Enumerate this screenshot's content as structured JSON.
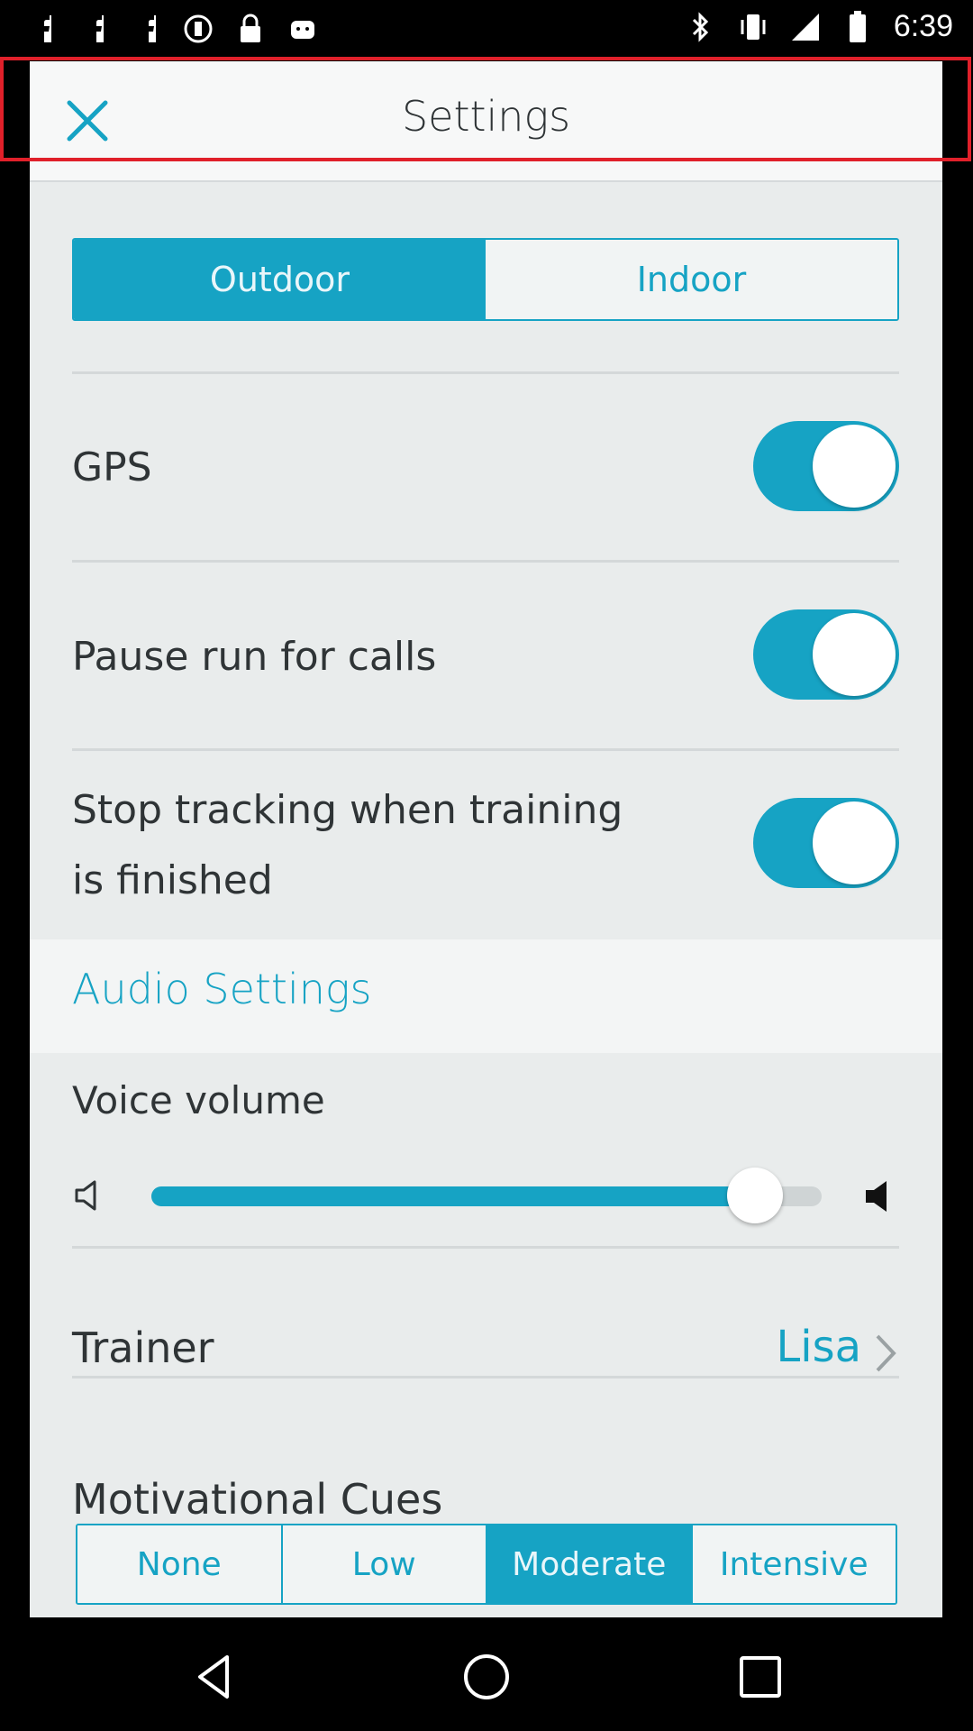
{
  "status_bar": {
    "time": "6:39",
    "left_icons": [
      "facebook-icon",
      "facebook-icon",
      "facebook-icon",
      "circle-notification-icon",
      "lock-icon",
      "android-icon"
    ],
    "right_icons": [
      "bluetooth-icon",
      "vibrate-icon",
      "signal-icon",
      "battery-icon"
    ]
  },
  "dialog": {
    "title": "Settings",
    "close_icon": "close-icon"
  },
  "location_mode": {
    "options": [
      "Outdoor",
      "Indoor"
    ],
    "selected": "Outdoor"
  },
  "toggles": [
    {
      "label": "GPS",
      "on": true
    },
    {
      "label": "Pause run for calls",
      "on": true
    },
    {
      "label": "Stop tracking when training is finished",
      "label_line1": "Stop tracking when training",
      "label_line2": "is finished",
      "on": true
    }
  ],
  "audio": {
    "section_title": "Audio Settings",
    "voice_volume_label": "Voice volume",
    "voice_volume_fraction": 0.9,
    "trainer_label": "Trainer",
    "trainer_value": "Lisa",
    "motivational_label": "Motivational Cues",
    "motivational_options": [
      "None",
      "Low",
      "Moderate",
      "Intensive"
    ],
    "motivational_selected": "Moderate"
  },
  "colors": {
    "accent": "#16a3c4",
    "highlight": "#e0202a"
  }
}
